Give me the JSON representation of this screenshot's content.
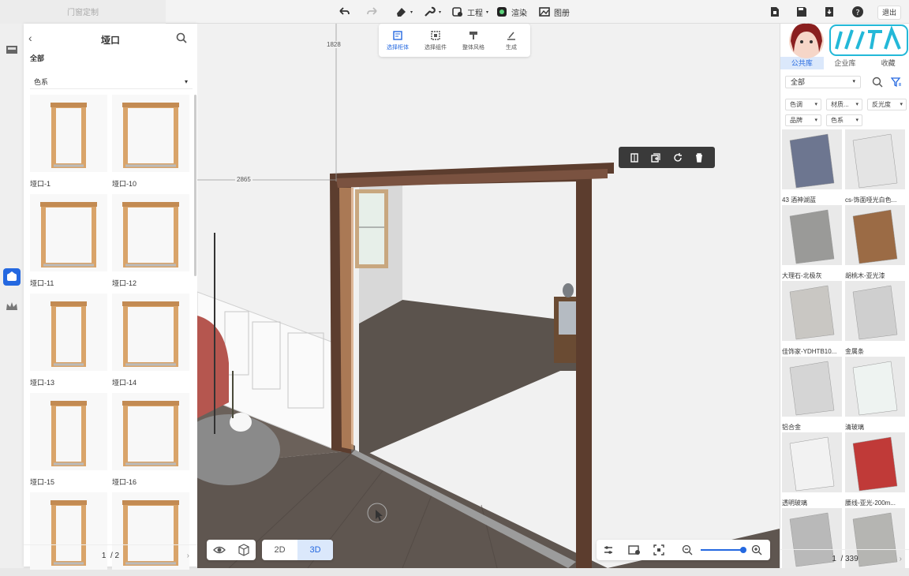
{
  "topbar": {
    "tab_title": "门窗定制",
    "undo_icon": "undo-icon",
    "redo_icon": "redo-icon",
    "tools": [
      {
        "label": "",
        "icon": "eraser-icon"
      },
      {
        "label": "",
        "icon": "wrench-icon"
      },
      {
        "label": "工程",
        "icon": "project-icon"
      },
      {
        "label": "渲染",
        "icon": "render-icon"
      },
      {
        "label": "图册",
        "icon": "album-icon"
      }
    ],
    "exit_label": "退出"
  },
  "left_panel": {
    "title": "垭口",
    "category": "全部",
    "filter": "色系",
    "items": [
      "垭口-1",
      "垭口-10",
      "垭口-11",
      "垭口-12",
      "垭口-13",
      "垭口-14",
      "垭口-15",
      "垭口-16",
      "",
      ""
    ],
    "page_current": "1",
    "page_total": "/ 2"
  },
  "view": {
    "dim_top": "1828",
    "dim_left": "2865",
    "selection_tools": [
      "选择柜体",
      "选择组件",
      "整体风格",
      "生成"
    ],
    "mode_2d": "2D",
    "mode_3d": "3D"
  },
  "right_panel": {
    "tabs": [
      "公共库",
      "企业库",
      "收藏"
    ],
    "category": "全部",
    "filters": [
      "色调",
      "材质...",
      "反光度",
      "品牌",
      "色系"
    ],
    "materials": [
      {
        "label": "43 酒神湖蓝",
        "color": "#6d7690"
      },
      {
        "label": "cs-饰面哑光白色...",
        "color": "#e4e4e4"
      },
      {
        "label": "大理石-北极灰",
        "color": "#9a9a98"
      },
      {
        "label": "胡桃木-亚光漆",
        "color": "#9b6b45"
      },
      {
        "label": "佳饰家-YDHTB10...",
        "color": "#c9c7c3"
      },
      {
        "label": "金属条",
        "color": "#cfcfcf"
      },
      {
        "label": "铝合金",
        "color": "#d5d5d5"
      },
      {
        "label": "清玻璃",
        "color": "#eef3f1"
      },
      {
        "label": "透明玻璃",
        "color": "#f2f2f2"
      },
      {
        "label": "腰线-亚光-200m...",
        "color": "#c03a38"
      },
      {
        "label": "",
        "color": "#b9b9b9"
      },
      {
        "label": "",
        "color": "#b5b5b2"
      }
    ],
    "page_current": "1",
    "page_total": "/ 339"
  },
  "colors": {
    "accent": "#2468e0",
    "wood": "#d9a46a",
    "frame": "#5c3d2e"
  }
}
